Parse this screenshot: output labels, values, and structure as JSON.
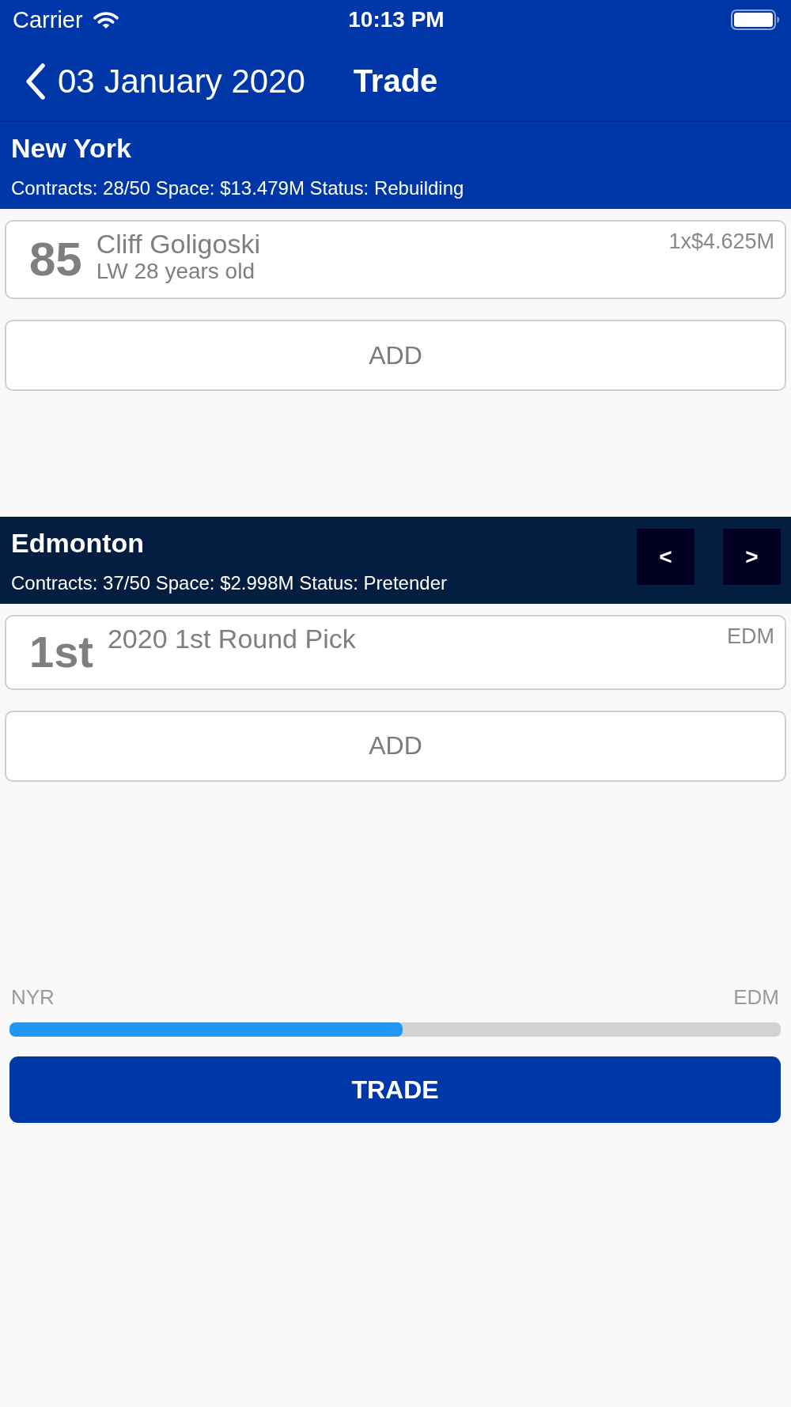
{
  "status_bar": {
    "carrier": "Carrier",
    "time": "10:13 PM"
  },
  "nav": {
    "back_label": "03 January 2020",
    "title": "Trade"
  },
  "teams": [
    {
      "name": "New York",
      "info": "Contracts: 28/50 Space: $13.479M Status: Rebuilding",
      "color": "#0037a8",
      "assets": [
        {
          "kind": "player",
          "rating": "85",
          "name": "Cliff Goligoski",
          "detail": "LW 28 years old",
          "value": "1x$4.625M"
        }
      ],
      "add_label": "ADD"
    },
    {
      "name": "Edmonton",
      "info": "Contracts: 37/50 Space: $2.998M Status: Pretender",
      "color": "#041e42",
      "switch_buttons": [
        "<",
        ">"
      ],
      "assets": [
        {
          "kind": "pick",
          "rating": "1st",
          "name": "2020 1st Round Pick",
          "value": "EDM"
        }
      ],
      "add_label": "ADD"
    }
  ],
  "balance": {
    "left_label": "NYR",
    "right_label": "EDM",
    "level": 0.51
  },
  "trade_button": "TRADE"
}
